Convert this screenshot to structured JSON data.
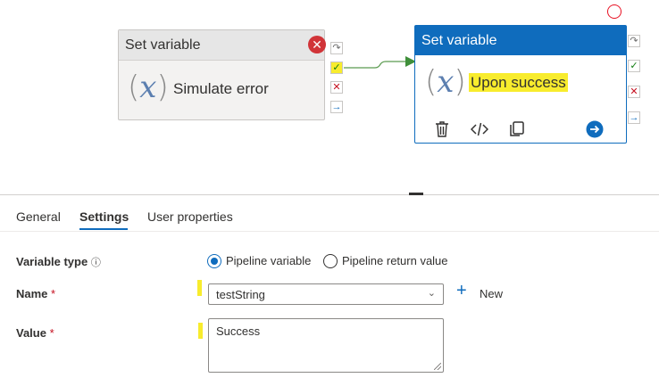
{
  "canvas": {
    "activity1": {
      "title": "Set variable",
      "name": "Simulate error",
      "status": "failed",
      "symbol": "x"
    },
    "activity2": {
      "title": "Set variable",
      "name": "Upon success",
      "symbol": "x",
      "toolbar": [
        "delete-icon",
        "code-icon",
        "copy-icon",
        "navigate-arrow-icon"
      ]
    },
    "ports": [
      "skip-port",
      "success-port",
      "failure-port",
      "completion-port"
    ],
    "colors": {
      "accent": "#0f6cbd",
      "success": "#107c10",
      "failure": "#c50f1f",
      "highlight": "#f8ec2d"
    }
  },
  "tabs": [
    {
      "label": "General"
    },
    {
      "label": "Settings",
      "active": true
    },
    {
      "label": "User properties"
    }
  ],
  "form": {
    "variable_type": {
      "label": "Variable type",
      "options": [
        "Pipeline variable",
        "Pipeline return value"
      ],
      "selected": "Pipeline variable"
    },
    "name": {
      "label": "Name",
      "required": "*",
      "value": "testString",
      "new_label": "New"
    },
    "value": {
      "label": "Value",
      "required": "*",
      "value": "Success"
    }
  }
}
